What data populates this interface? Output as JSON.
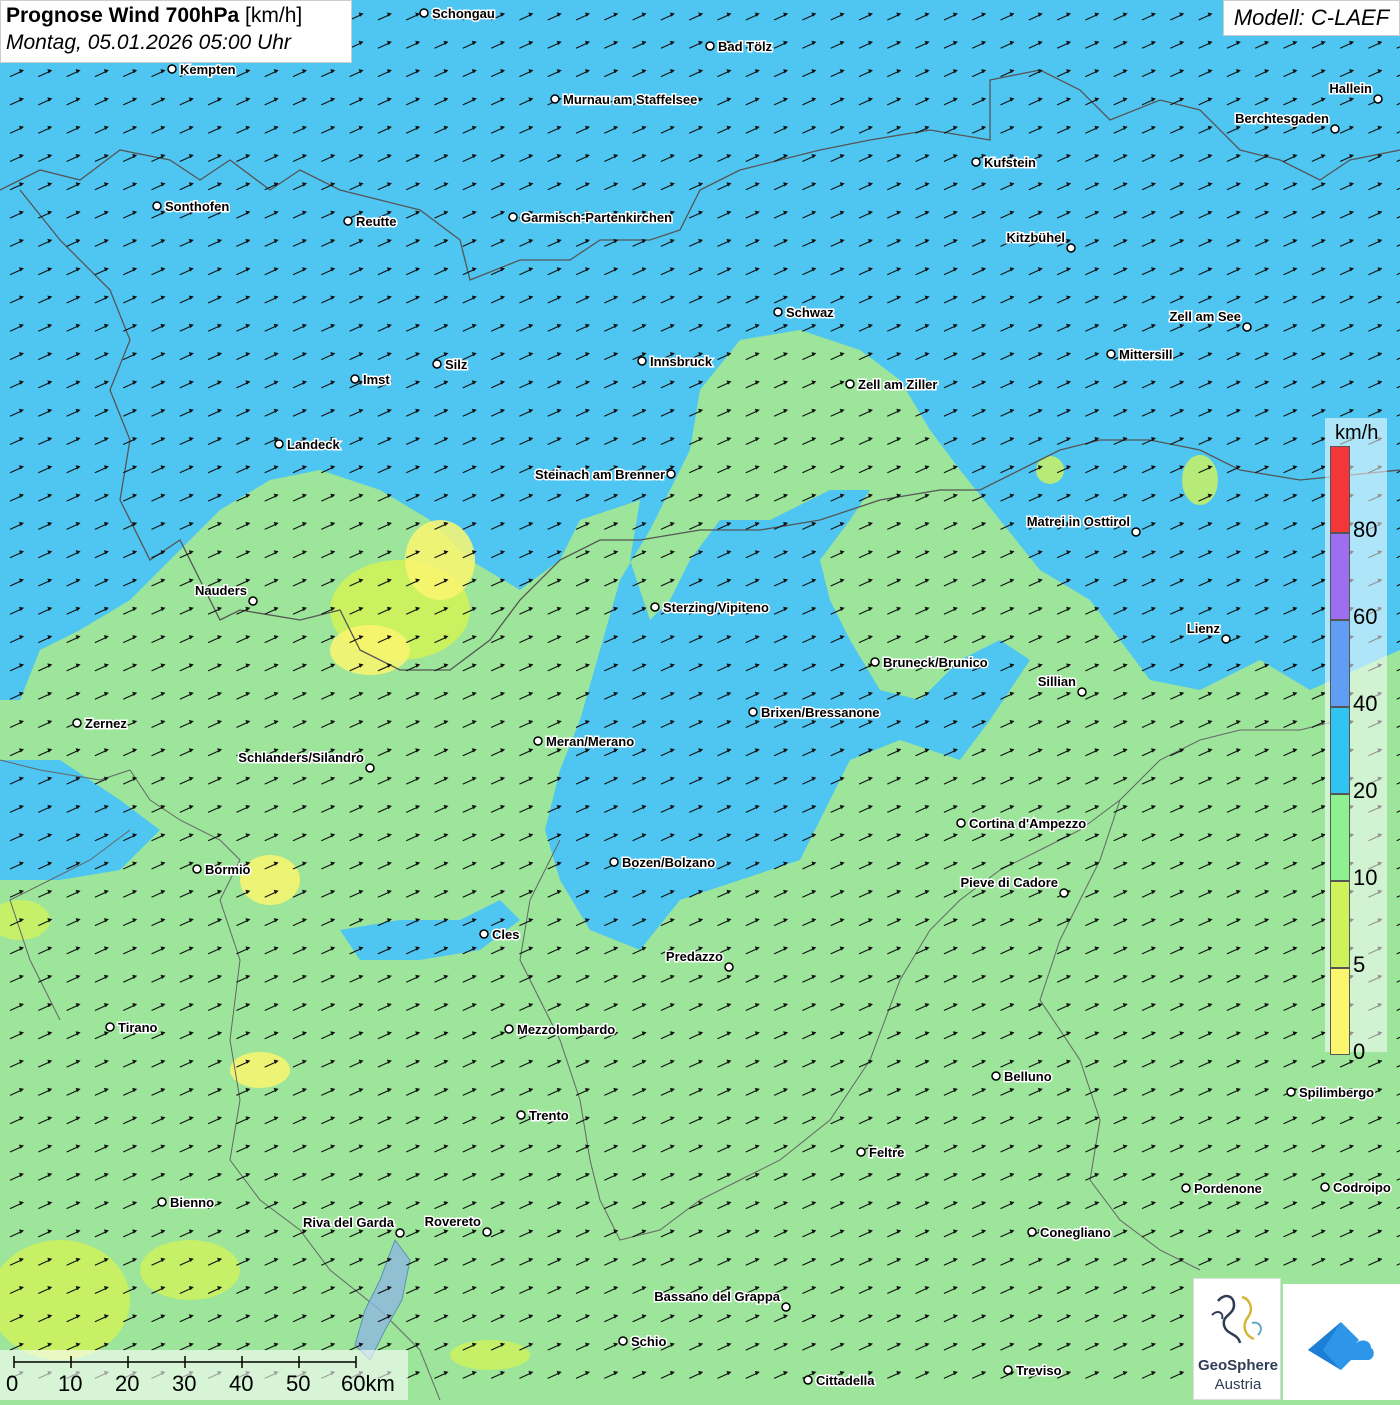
{
  "header": {
    "title_bold": "Prognose Wind 700hPa",
    "title_unit": "[km/h]",
    "datetime": "Montag, 05.01.2026 05:00 Uhr",
    "model": "Modell: C-LAEF"
  },
  "legend": {
    "unit": "km/h",
    "classes": [
      {
        "label": "80",
        "color": "#f2363a"
      },
      {
        "label": "60",
        "color": "#9b6ff0"
      },
      {
        "label": "40",
        "color": "#5f9ef2"
      },
      {
        "label": "20",
        "color": "#31c4f2"
      },
      {
        "label": "10",
        "color": "#8ff08f"
      },
      {
        "label": "5",
        "color": "#cff25a"
      },
      {
        "label": "0",
        "color": "#fbf66e"
      }
    ]
  },
  "scalebar": {
    "labels": [
      "0",
      "10",
      "20",
      "30",
      "40",
      "50",
      "60km"
    ]
  },
  "logos": {
    "geosphere_name": "GeoSphere",
    "geosphere_sub": "Austria"
  },
  "colors": {
    "wind_0_5": "#fbf66e",
    "wind_5_10": "#cff25a",
    "wind_10_20": "#9ce59a",
    "wind_20_40": "#4fc6f2",
    "border": "#555555"
  },
  "cities": [
    "Schongau",
    "Bad Tölz",
    "Kempten",
    "Murnau am Staffelsee",
    "Hallein",
    "Berchtesgaden",
    "Kufstein",
    "Sonthofen",
    "Reutte",
    "Garmisch-Partenkirchen",
    "Kitzbühel",
    "Schwaz",
    "Zell am See",
    "Mittersill",
    "Innsbruck",
    "Silz",
    "Imst",
    "Zell am Ziller",
    "Landeck",
    "Steinach am Brenner",
    "Matrei in Osttirol",
    "Nauders",
    "Sterzing/Vipiteno",
    "Lienz",
    "Bruneck/Brunico",
    "Sillian",
    "Brixen/Bressanone",
    "Zernez",
    "Meran/Merano",
    "Schlanders/Silandro",
    "Cortina d'Ampezzo",
    "Bozen/Bolzano",
    "Bormio",
    "Pieve di Cadore",
    "Cles",
    "Predazzo",
    "Tirano",
    "Mezzolombardo",
    "Belluno",
    "Spilimbergo",
    "Trento",
    "Feltre",
    "Bienno",
    "Pordenone",
    "Codroipo",
    "Riva del Garda",
    "Rovereto",
    "Conegliano",
    "Bassano del Grappa",
    "Schio",
    "Treviso",
    "Cittadella"
  ]
}
